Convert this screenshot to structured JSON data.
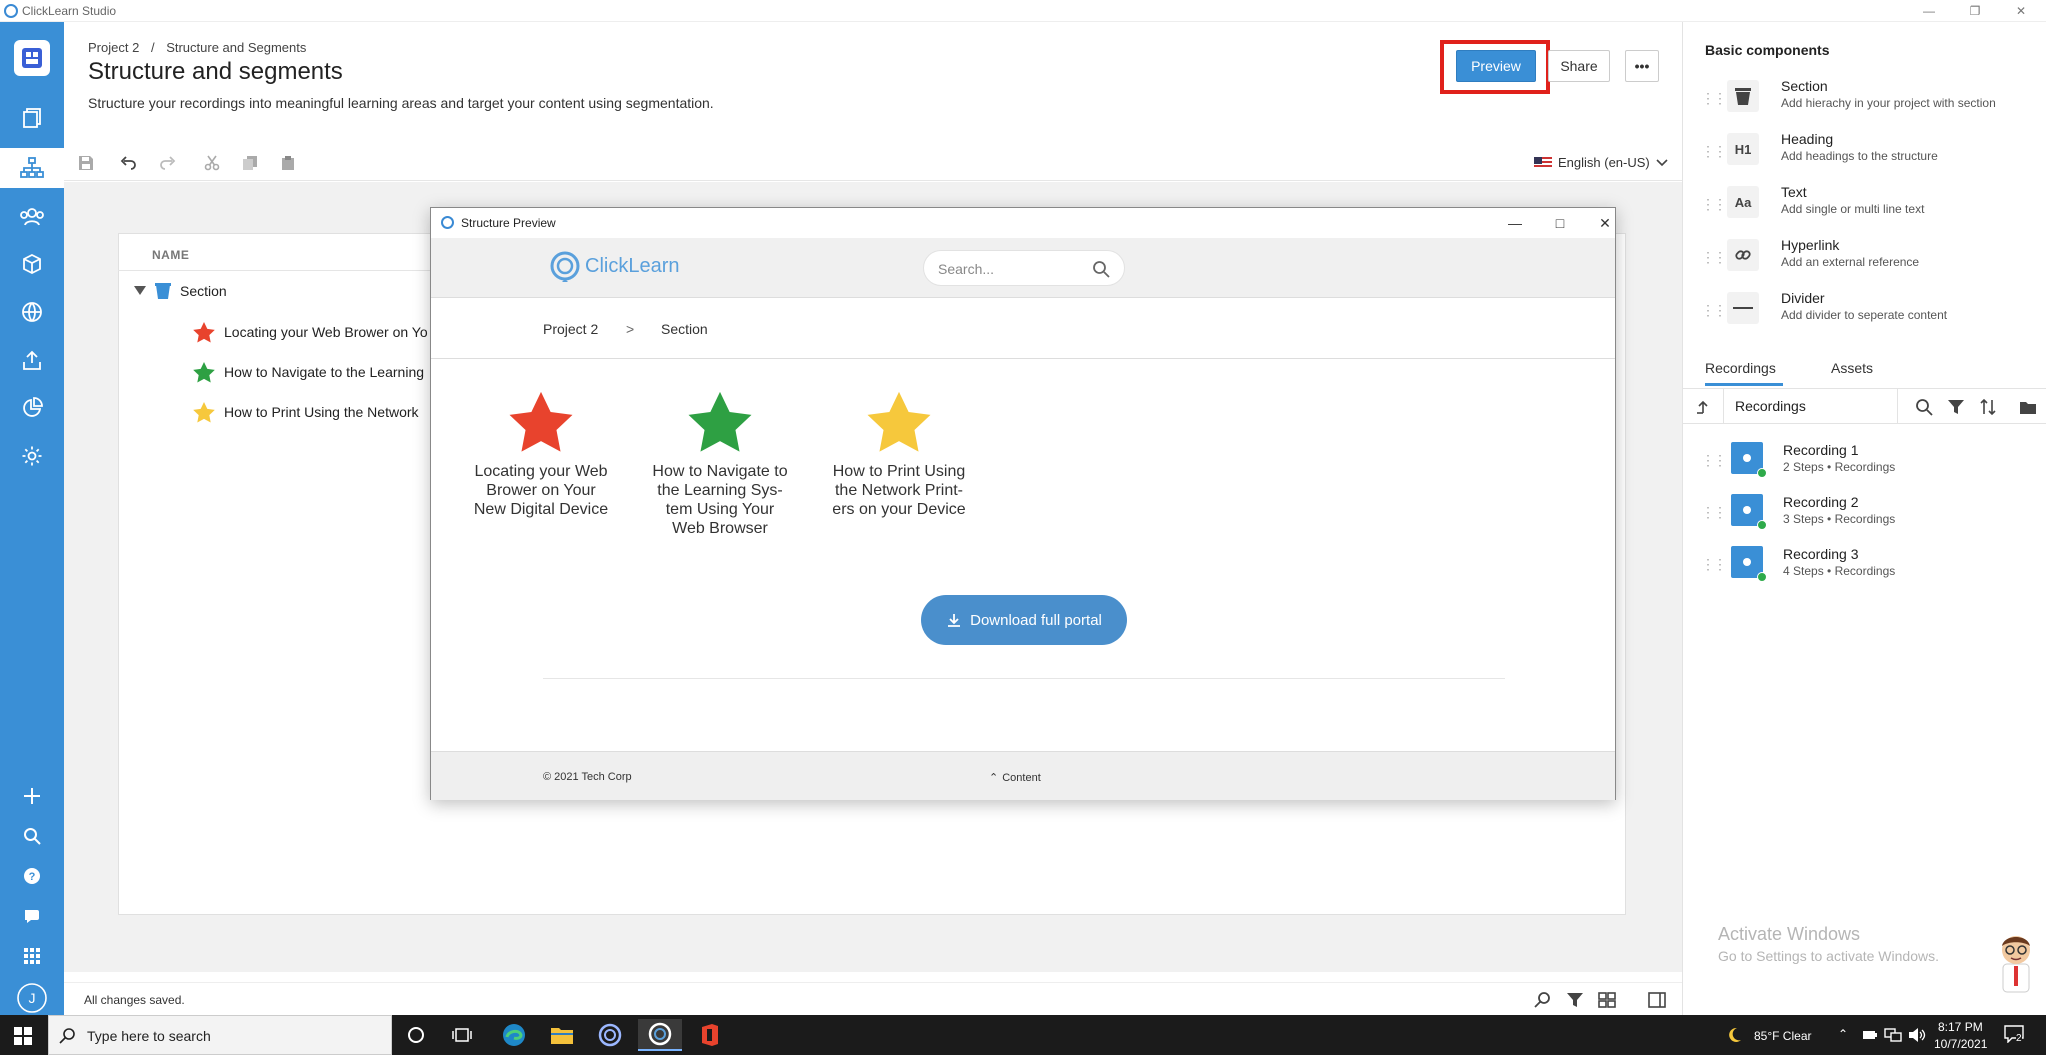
{
  "window": {
    "title": "ClickLearn Studio"
  },
  "header": {
    "breadcrumb": [
      "Project 2",
      "/",
      "Structure and Segments"
    ],
    "title": "Structure and segments",
    "description": "Structure your recordings into meaningful learning areas and target your content using segmentation.",
    "preview_label": "Preview",
    "share_label": "Share",
    "more_label": "•••"
  },
  "toolbar": {
    "language": "English (en-US)"
  },
  "tree": {
    "column_name": "NAME",
    "section_label": "Section",
    "items": [
      {
        "label": "Locating your Web Brower on Yo",
        "star_color": "#e8432d"
      },
      {
        "label": "How to Navigate to the Learning",
        "star_color": "#2ea043"
      },
      {
        "label": "How to Print Using the Network",
        "star_color": "#f6c83c"
      }
    ]
  },
  "status": {
    "text": "All changes saved."
  },
  "right_panel": {
    "title": "Basic components",
    "components": [
      {
        "name": "Section",
        "desc": "Add hierachy in your project with section",
        "icon": "trash-section-icon",
        "glyph": ""
      },
      {
        "name": "Heading",
        "desc": "Add headings to the structure",
        "icon": "heading-icon",
        "glyph": "H1"
      },
      {
        "name": "Text",
        "desc": "Add single or multi line text",
        "icon": "text-icon",
        "glyph": "Aa"
      },
      {
        "name": "Hyperlink",
        "desc": "Add an external reference",
        "icon": "link-icon",
        "glyph": ""
      },
      {
        "name": "Divider",
        "desc": "Add divider to seperate content",
        "icon": "divider-icon",
        "glyph": ""
      }
    ],
    "tabs": [
      "Recordings",
      "Assets"
    ],
    "recordings_folder": "Recordings",
    "recordings": [
      {
        "name": "Recording 1",
        "sub": "2 Steps • Recordings"
      },
      {
        "name": "Recording 2",
        "sub": "3 Steps • Recordings"
      },
      {
        "name": "Recording 3",
        "sub": "4 Steps • Recordings"
      }
    ],
    "activate_title": "Activate Windows",
    "activate_sub": "Go to Settings to activate Windows."
  },
  "preview": {
    "window_title": "Structure Preview",
    "logo_text": "ClickLearn",
    "search_placeholder": "Search...",
    "crumbs": [
      "Project 2",
      ">",
      "Section"
    ],
    "cards": [
      {
        "label": "Locating your Web Brower on Your New Digital Device",
        "color": "#e8432d"
      },
      {
        "label": "How to Navigate to the Learning Sys- tem Using Your Web Browser",
        "color": "#2ea043"
      },
      {
        "label": "How to Print Using the Network Print- ers on your Device",
        "color": "#f6c83c"
      }
    ],
    "download_label": "Download full portal",
    "copyright": "© 2021 Tech Corp",
    "content_label": "Content"
  },
  "taskbar": {
    "search_placeholder": "Type here to search",
    "weather": "85°F  Clear",
    "time": "8:17 PM",
    "date": "10/7/2021",
    "notifications": "2"
  },
  "colors": {
    "accent": "#3a8fd6",
    "highlight": "#e0211b"
  }
}
